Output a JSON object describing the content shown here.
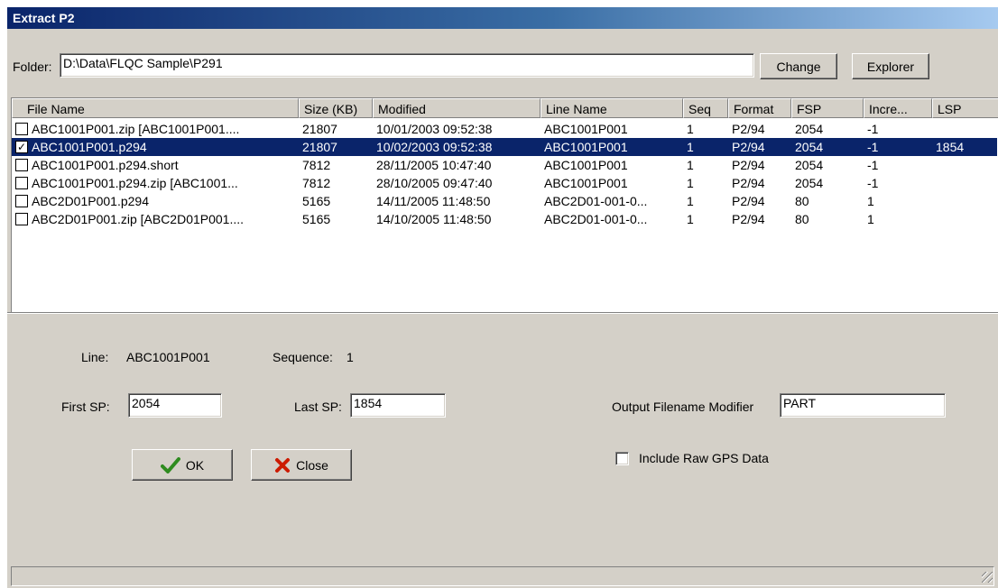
{
  "window": {
    "title": "Extract P2"
  },
  "folder": {
    "label": "Folder:",
    "value": "D:\\Data\\FLQC Sample\\P291",
    "change_label": "Change",
    "explorer_label": "Explorer"
  },
  "table": {
    "columns": [
      "File Name",
      "Size (KB)",
      "Modified",
      "Line Name",
      "Seq",
      "Format",
      "FSP",
      "Incre...",
      "LSP"
    ],
    "rows": [
      {
        "checked": false,
        "selected": false,
        "cells": [
          "ABC1001P001.zip [ABC1001P001....",
          "21807",
          "10/01/2003 09:52:38",
          "ABC1001P001",
          "1",
          "P2/94",
          "2054",
          "-1",
          ""
        ]
      },
      {
        "checked": true,
        "selected": true,
        "cells": [
          "ABC1001P001.p294",
          "21807",
          "10/02/2003 09:52:38",
          "ABC1001P001",
          "1",
          "P2/94",
          "2054",
          "-1",
          "1854"
        ]
      },
      {
        "checked": false,
        "selected": false,
        "cells": [
          "ABC1001P001.p294.short",
          "7812",
          "28/11/2005 10:47:40",
          "ABC1001P001",
          "1",
          "P2/94",
          "2054",
          "-1",
          ""
        ]
      },
      {
        "checked": false,
        "selected": false,
        "cells": [
          "ABC1001P001.p294.zip [ABC1001...",
          "7812",
          "28/10/2005 09:47:40",
          "ABC1001P001",
          "1",
          "P2/94",
          "2054",
          "-1",
          ""
        ]
      },
      {
        "checked": false,
        "selected": false,
        "cells": [
          "ABC2D01P001.p294",
          "5165",
          "14/11/2005 11:48:50",
          "ABC2D01-001-0...",
          "1",
          "P2/94",
          "80",
          "1",
          ""
        ]
      },
      {
        "checked": false,
        "selected": false,
        "cells": [
          "ABC2D01P001.zip [ABC2D01P001....",
          "5165",
          "14/10/2005 11:48:50",
          "ABC2D01-001-0...",
          "1",
          "P2/94",
          "80",
          "1",
          ""
        ]
      }
    ]
  },
  "info": {
    "line_label": "Line:",
    "line_value": "ABC1001P001",
    "sequence_label": "Sequence:",
    "sequence_value": "1"
  },
  "fields": {
    "first_sp_label": "First SP:",
    "first_sp_value": "2054",
    "last_sp_label": "Last SP:",
    "last_sp_value": "1854",
    "output_label": "Output Filename Modifier",
    "output_value": "PART"
  },
  "buttons": {
    "ok_label": "OK",
    "close_label": "Close"
  },
  "include_gps": {
    "label": "Include Raw GPS Data",
    "checked": false
  },
  "colors": {
    "selection": "#0a246a",
    "face": "#d4d0c8",
    "ok_icon": "#2e8b1f",
    "close_icon": "#cc1b00"
  },
  "icons": {
    "ok": "checkmark-icon",
    "close": "x-icon"
  }
}
